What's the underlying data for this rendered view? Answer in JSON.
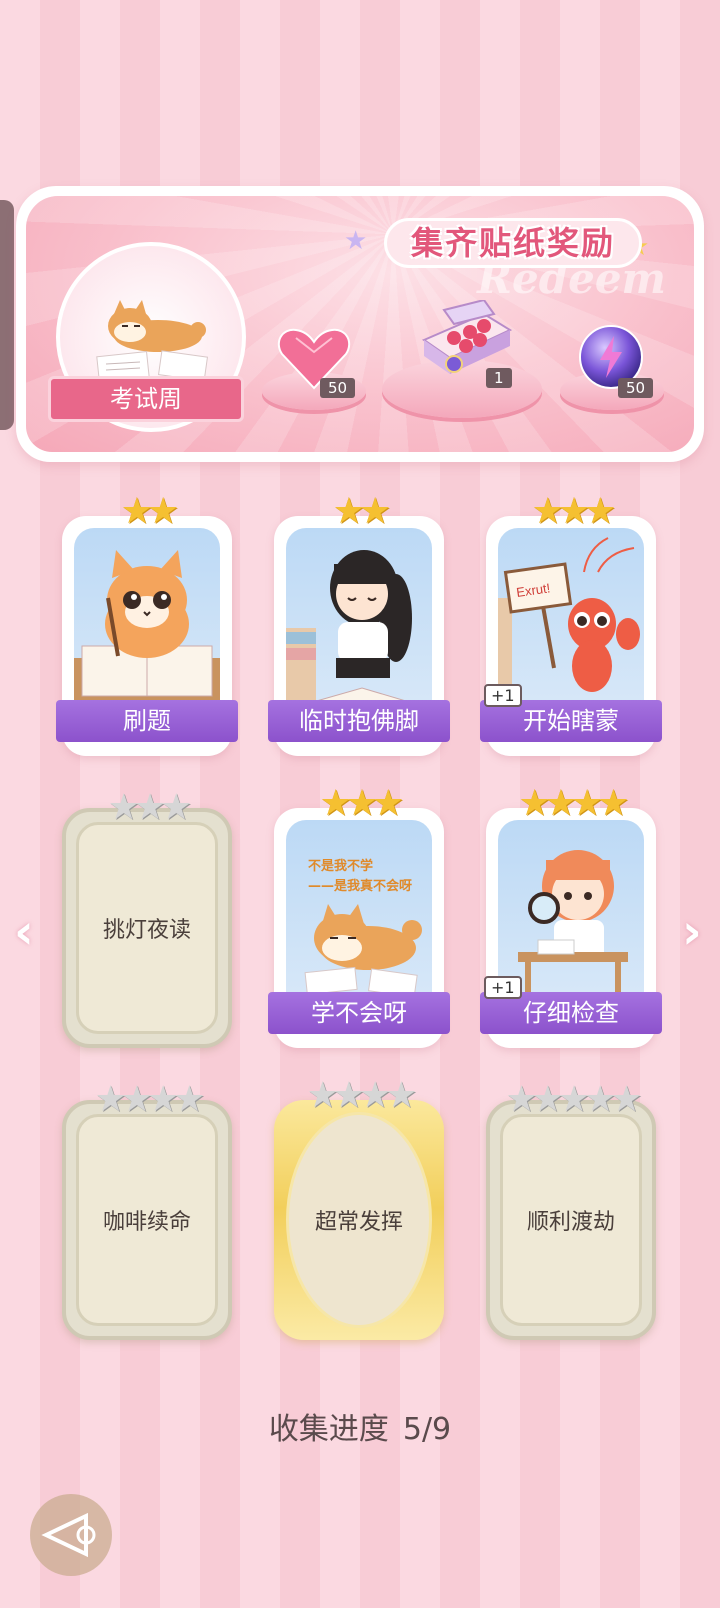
{
  "banner": {
    "title": "集齐贴纸奖励",
    "watermark": "Redeem",
    "badge_label": "考试周",
    "rewards": [
      {
        "icon": "heart-gem-icon",
        "count": "50"
      },
      {
        "icon": "gift-box-icon",
        "count": "1"
      },
      {
        "icon": "energy-orb-icon",
        "count": "50"
      }
    ]
  },
  "stickers": [
    {
      "name": "刷题",
      "stars": 2,
      "unlocked": true,
      "plus": "",
      "art": "cat-studying-art"
    },
    {
      "name": "临时抱佛脚",
      "stars": 2,
      "unlocked": true,
      "plus": "",
      "art": "girl-reading-art"
    },
    {
      "name": "开始瞎蒙",
      "stars": 3,
      "unlocked": true,
      "plus": "+1",
      "art": "shrimp-sign-art",
      "sign_text": "Exrut!"
    },
    {
      "name": "挑灯夜读",
      "stars": 3,
      "unlocked": false,
      "plus": ""
    },
    {
      "name": "学不会呀",
      "stars": 3,
      "unlocked": true,
      "plus": "",
      "art": "shiba-lying-art",
      "caption_line1": "不是我不学",
      "caption_line2": "——是我真不会呀"
    },
    {
      "name": "仔细检查",
      "stars": 4,
      "unlocked": true,
      "plus": "+1",
      "art": "girl-magnifier-art"
    },
    {
      "name": "咖啡续命",
      "stars": 4,
      "unlocked": false,
      "plus": ""
    },
    {
      "name": "超常发挥",
      "stars": 4,
      "unlocked": false,
      "plus": "",
      "gold": true
    },
    {
      "name": "顺利渡劫",
      "stars": 5,
      "unlocked": false,
      "plus": ""
    }
  ],
  "progress": {
    "label": "收集进度",
    "value": "5/9"
  },
  "colors": {
    "accent": "#e2577b",
    "label_purple": "#8c52cc",
    "background": "#fbd9e1"
  }
}
